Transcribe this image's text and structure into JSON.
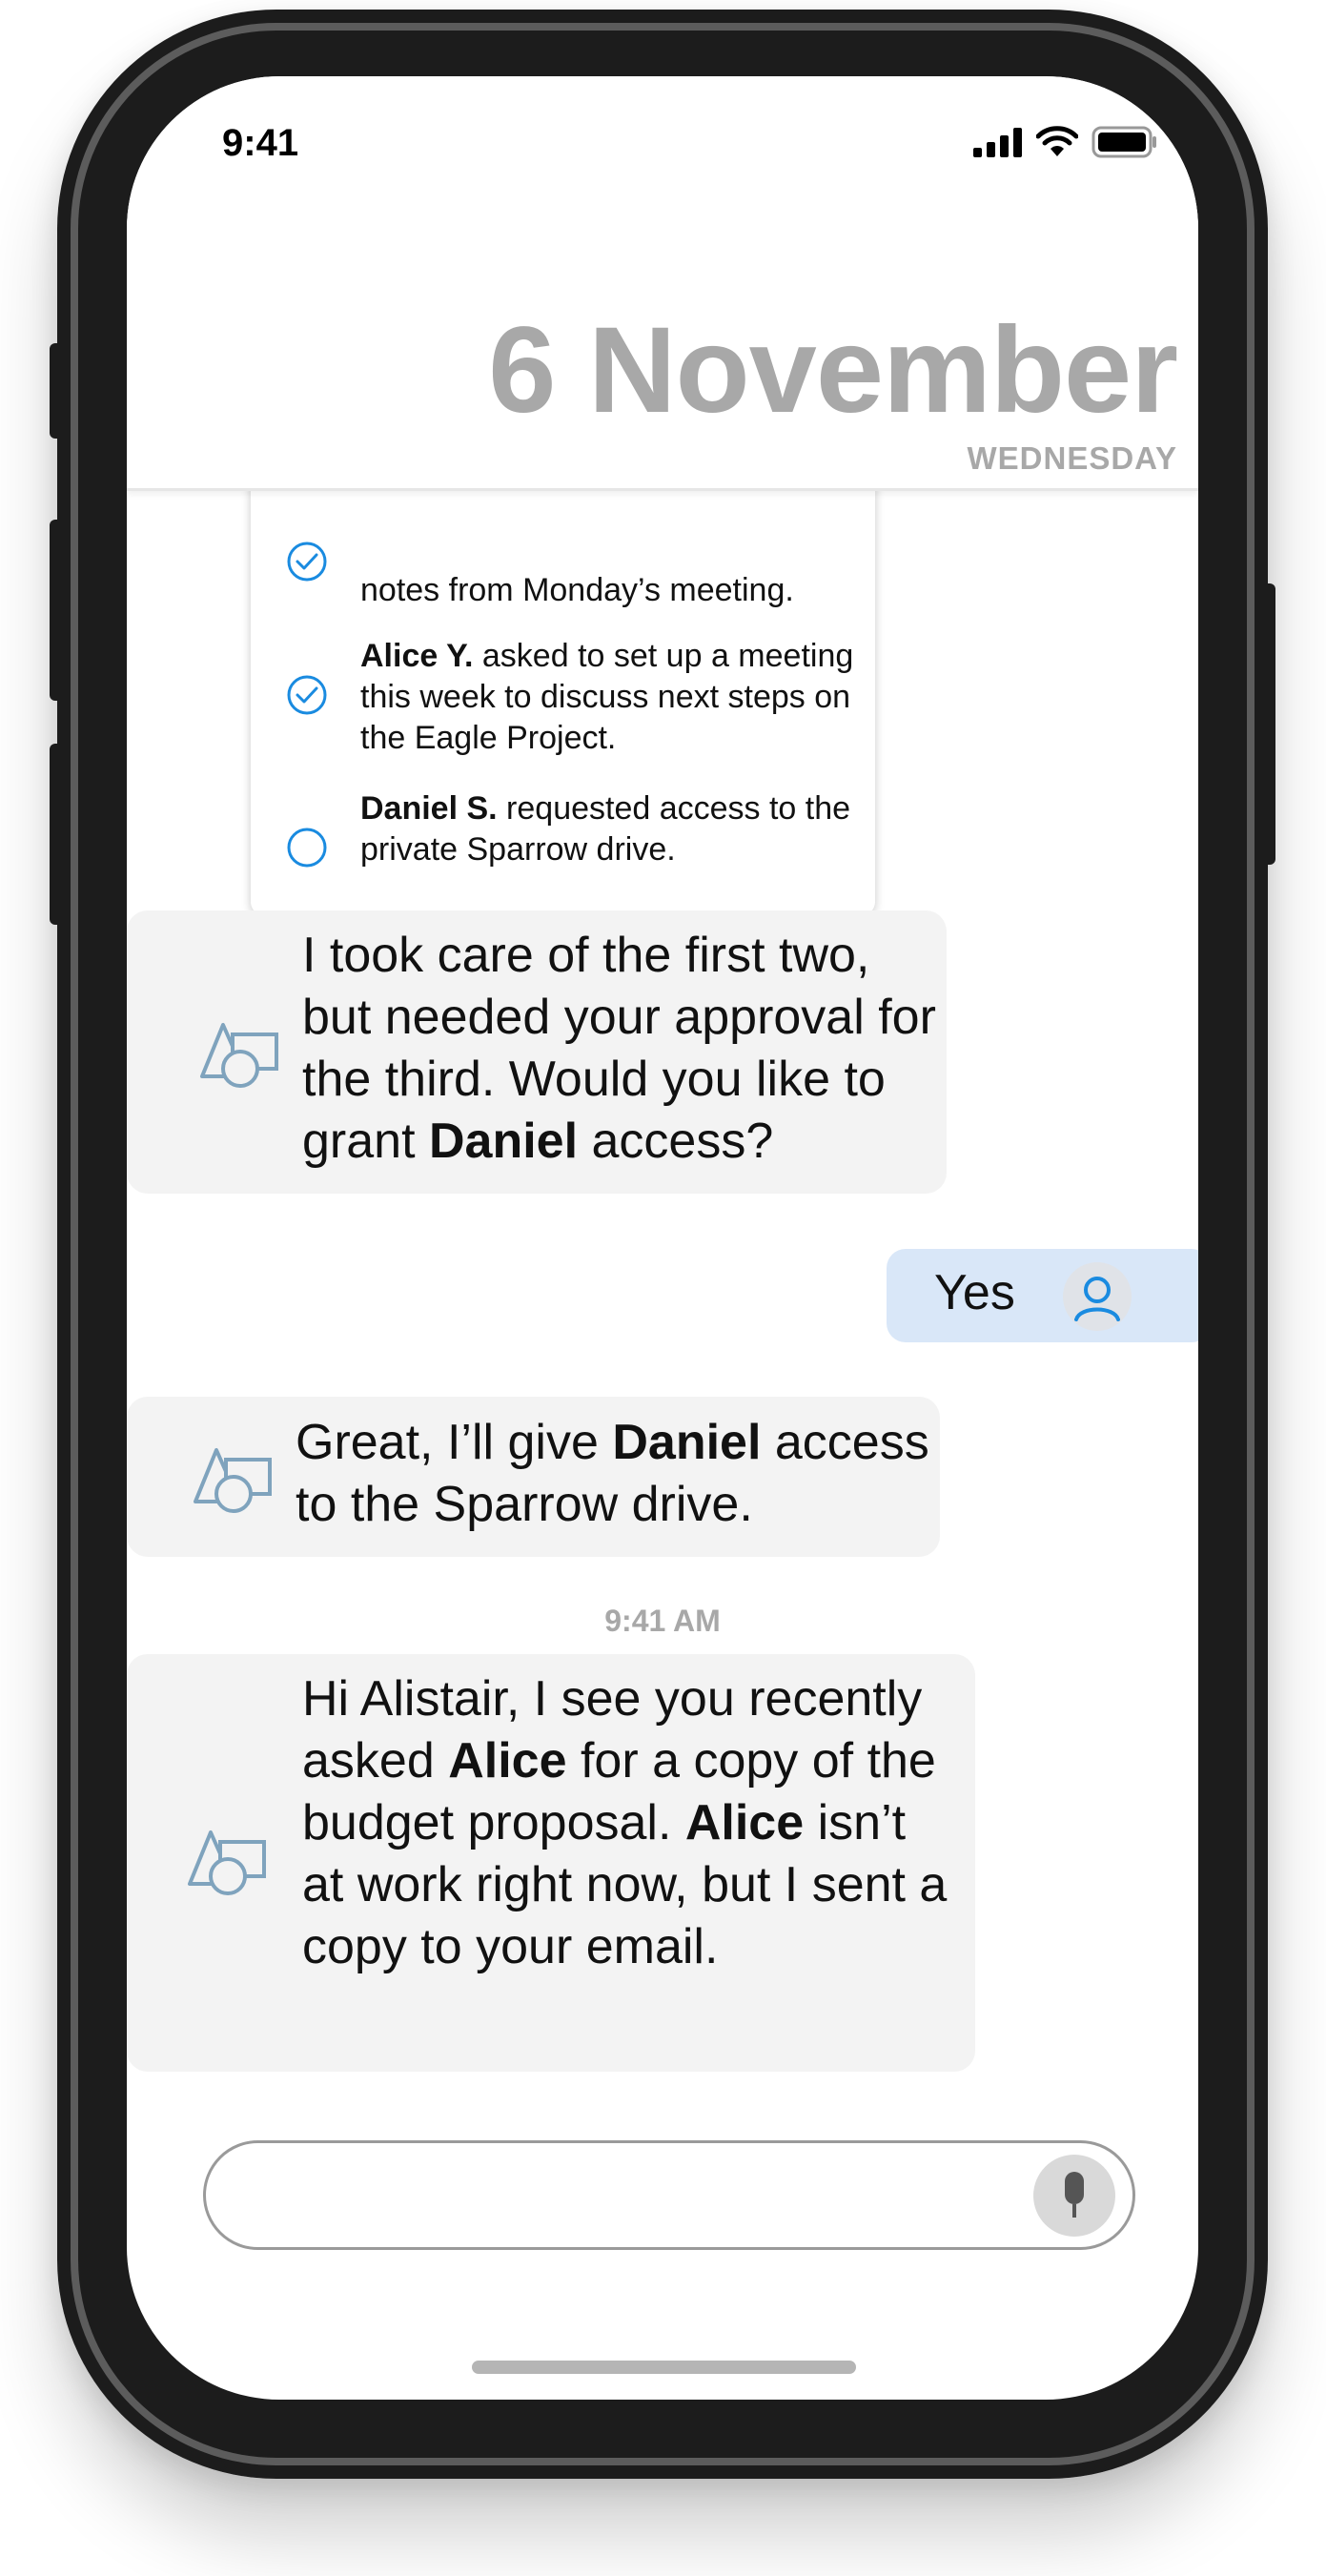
{
  "status_bar": {
    "time": "9:41"
  },
  "header": {
    "date": "6 November",
    "weekday": "WEDNESDAY"
  },
  "tasks": [
    {
      "name_bold": "",
      "text": "notes from Monday’s meeting.",
      "checked": true
    },
    {
      "name_bold": "Alice Y.",
      "text": " asked to set up a meeting this week to discuss next steps on the Eagle Project.",
      "checked": true
    },
    {
      "name_bold": "Daniel S.",
      "text": " requested access to the private Sparrow drive.",
      "checked": false
    }
  ],
  "messages": {
    "bot1": {
      "part1": "I took care of the first two, but needed your approval for the third. Would you like to grant ",
      "bold1": "Daniel",
      "part2": " access?"
    },
    "user1": {
      "text": "Yes"
    },
    "bot2": {
      "part1": "Great, I’ll give ",
      "bold1": "Daniel",
      "part2": " access to the Sparrow drive."
    },
    "timestamp": "9:41 AM",
    "bot3": {
      "part1": "Hi Alistair, I see you recently asked ",
      "bold1": "Alice",
      "part2": " for a copy of the budget proposal. ",
      "bold2": "Alice",
      "part3": " isn’t at work right now, but I sent a copy to your email."
    }
  },
  "input": {
    "placeholder": ""
  },
  "colors": {
    "accent_blue": "#1a8be0",
    "user_bubble": "#d9e7f8",
    "bot_bubble": "#f3f3f3",
    "header_gray": "#a8a8a8",
    "bot_icon": "#7fa3bd"
  },
  "icons": {
    "bot": "shapes-icon",
    "user": "user-avatar-icon",
    "mic": "microphone-icon",
    "check": "check-circle-icon",
    "unchecked": "empty-circle-icon"
  }
}
